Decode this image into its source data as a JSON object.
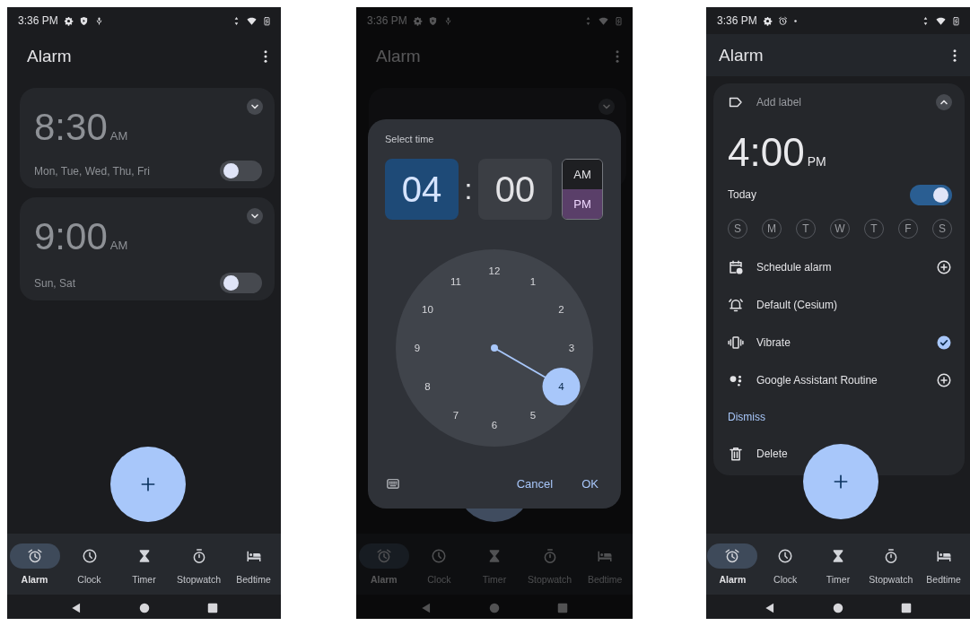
{
  "screens": [
    {
      "kind": "alarm_list",
      "status_bar": {
        "time": "3:36 PM"
      },
      "title": "Alarm",
      "alarms": [
        {
          "time": "8:30",
          "period": "AM",
          "days": "Mon, Tue, Wed, Thu, Fri",
          "on": false,
          "expanded": false
        },
        {
          "time": "9:00",
          "period": "AM",
          "days": "Sun, Sat",
          "on": false,
          "expanded": false
        }
      ],
      "tabs": [
        {
          "label": "Alarm",
          "selected": true
        },
        {
          "label": "Clock",
          "selected": false
        },
        {
          "label": "Timer",
          "selected": false
        },
        {
          "label": "Stopwatch",
          "selected": false
        },
        {
          "label": "Bedtime",
          "selected": false
        }
      ]
    },
    {
      "kind": "time_picker",
      "status_bar": {
        "time": "3:36 PM"
      },
      "title": "Alarm",
      "alarms": [
        {
          "expanded": false
        }
      ],
      "tabs": [
        {
          "label": "Alarm",
          "selected": true
        },
        {
          "label": "Clock",
          "selected": false
        },
        {
          "label": "Timer",
          "selected": false
        },
        {
          "label": "Stopwatch",
          "selected": false
        },
        {
          "label": "Bedtime",
          "selected": false
        }
      ],
      "dialog": {
        "title": "Select time",
        "fields": [
          {
            "value": "04",
            "selected": true
          },
          {
            "value": "00",
            "selected": false
          }
        ],
        "separator": ":",
        "periods": [
          {
            "label": "AM",
            "selected": false
          },
          {
            "label": "PM",
            "selected": true
          }
        ],
        "dial": [
          {
            "label": "12",
            "selected": false
          },
          {
            "label": "1",
            "selected": false
          },
          {
            "label": "2",
            "selected": false
          },
          {
            "label": "3",
            "selected": false
          },
          {
            "label": "4",
            "selected": true
          },
          {
            "label": "5",
            "selected": false
          },
          {
            "label": "6",
            "selected": false
          },
          {
            "label": "7",
            "selected": false
          },
          {
            "label": "8",
            "selected": false
          },
          {
            "label": "9",
            "selected": false
          },
          {
            "label": "10",
            "selected": false
          },
          {
            "label": "11",
            "selected": false
          }
        ],
        "buttons": [
          {
            "label": "Cancel"
          },
          {
            "label": "OK"
          }
        ]
      }
    },
    {
      "kind": "alarm_detail",
      "status_bar": {
        "time": "3:36 PM"
      },
      "title": "Alarm",
      "alarm": {
        "label_placeholder": "Add label",
        "expanded": true,
        "time": "4:00",
        "period": "PM",
        "schedule": "Today",
        "on": true,
        "days": [
          {
            "letter": "S",
            "selected": false
          },
          {
            "letter": "M",
            "selected": false
          },
          {
            "letter": "T",
            "selected": false
          },
          {
            "letter": "W",
            "selected": false
          },
          {
            "letter": "T",
            "selected": false
          },
          {
            "letter": "F",
            "selected": false
          },
          {
            "letter": "S",
            "selected": false
          }
        ],
        "options": [
          {
            "kind": "schedule",
            "label": "Schedule alarm"
          },
          {
            "kind": "ringtone",
            "label": "Default (Cesium)"
          },
          {
            "kind": "vibrate",
            "label": "Vibrate",
            "checked": true
          },
          {
            "kind": "assistant",
            "label": "Google Assistant Routine"
          }
        ],
        "dismiss": "Dismiss",
        "delete": "Delete"
      },
      "tabs": [
        {
          "label": "Alarm",
          "selected": true
        },
        {
          "label": "Clock",
          "selected": false
        },
        {
          "label": "Timer",
          "selected": false
        },
        {
          "label": "Stopwatch",
          "selected": false
        },
        {
          "label": "Bedtime",
          "selected": false
        }
      ]
    }
  ]
}
